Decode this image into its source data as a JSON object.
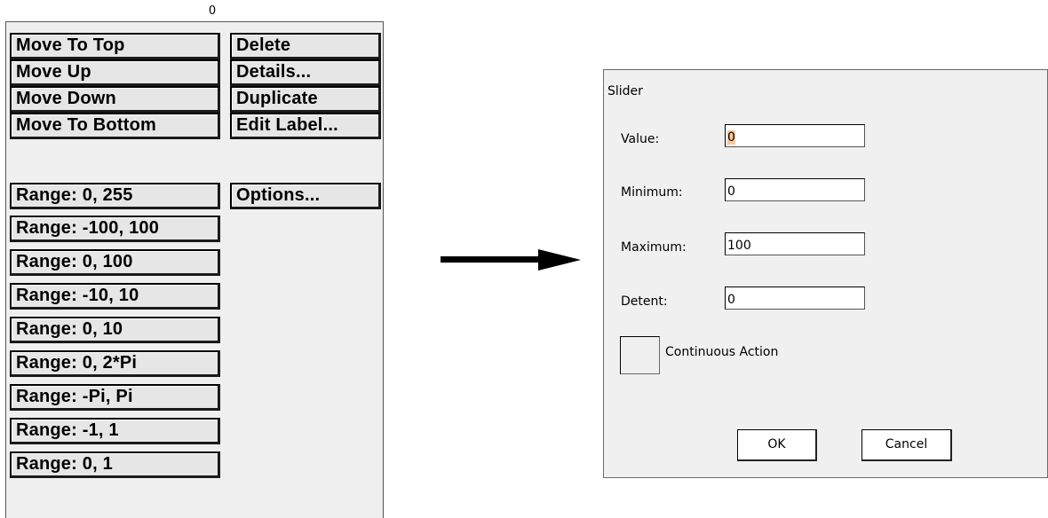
{
  "slider_value": "0",
  "menu": {
    "left_column": [
      "Move To Top",
      "Move Up",
      "Move Down",
      "Move To Bottom"
    ],
    "right_column": [
      "Delete",
      "Details...",
      "Duplicate",
      "Edit Label..."
    ],
    "options": "Options...",
    "ranges": [
      "Range: 0, 255",
      "Range: -100, 100",
      "Range: 0, 100",
      "Range: -10, 10",
      "Range: 0, 10",
      "Range: 0, 2*Pi",
      "Range: -Pi, Pi",
      "Range: -1, 1",
      "Range: 0, 1"
    ]
  },
  "dialog": {
    "title": "Slider",
    "fields": [
      {
        "label": "Value:",
        "value": "0"
      },
      {
        "label": "Minimum:",
        "value": "0"
      },
      {
        "label": "Maximum:",
        "value": "100"
      },
      {
        "label": "Detent:",
        "value": "0"
      }
    ],
    "checkbox_label": "Continuous Action",
    "ok": "OK",
    "cancel": "Cancel"
  },
  "colors": {
    "menu_bg": "#efefef",
    "button_bg": "#e6e6e6",
    "dialog_bg": "#f0f0f0",
    "value_highlight": "#f6c79e"
  }
}
